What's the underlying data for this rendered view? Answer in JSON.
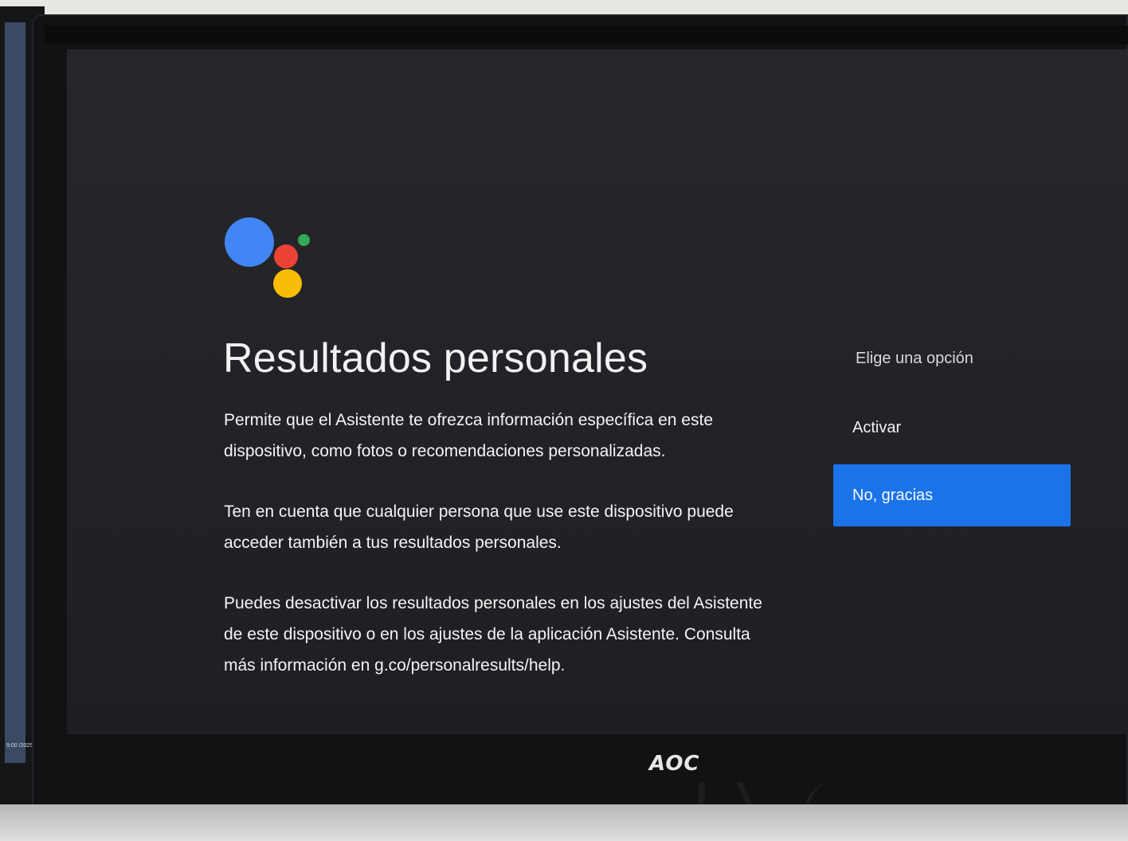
{
  "left_monitor": {
    "time_text": "9:00\n/2025"
  },
  "screen": {
    "title": "Resultados personales",
    "body": [
      "Permite que el Asistente te ofrezca información específica en este dispositivo, como fotos o recomendaciones personalizadas.",
      "Ten en cuenta que cualquier persona que use este dispositivo puede acceder también a tus resultados personales.",
      "Puedes desactivar los resultados personales en los ajustes del Asistente de este dispositivo o en los ajustes de la aplicación Asistente. Consulta más información en g.co/personalresults/help."
    ],
    "options": {
      "heading": "Elige una opción",
      "items": [
        {
          "label": "Activar",
          "selected": false
        },
        {
          "label": "No, gracias",
          "selected": true
        }
      ]
    },
    "colors": {
      "background": "#232428",
      "selected_option": "#1a73e8",
      "assistant_blue": "#4285f4",
      "assistant_red": "#ea4335",
      "assistant_yellow": "#fbbc05",
      "assistant_green": "#34a853"
    },
    "icons": {
      "logo": "google-assistant-logo-icon"
    }
  },
  "monitor": {
    "brand": "AOC"
  }
}
